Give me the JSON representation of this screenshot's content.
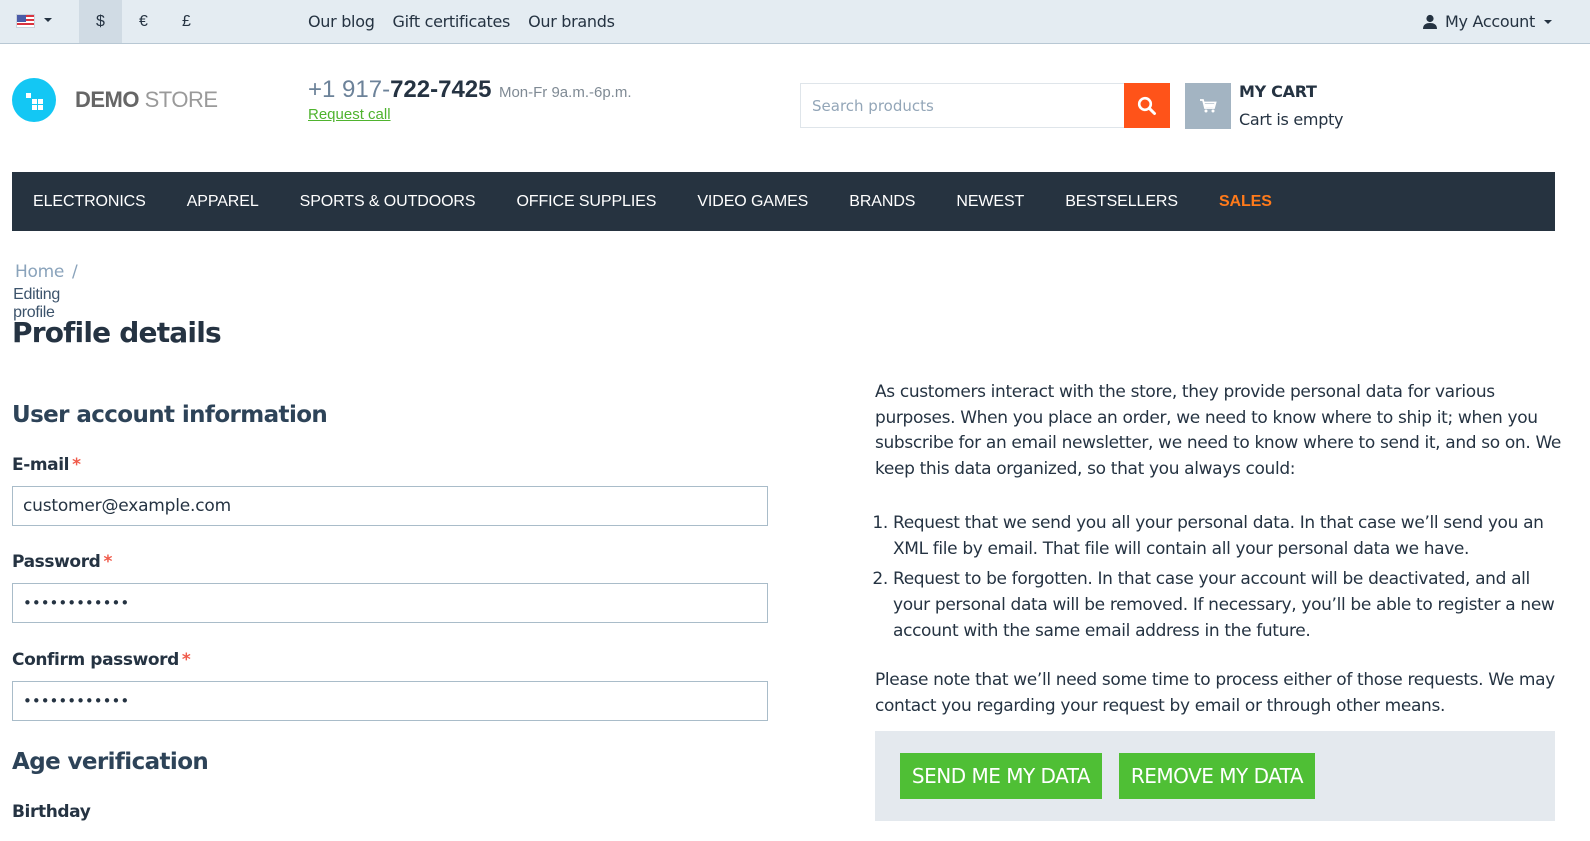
{
  "topbar": {
    "language": {
      "icon": "us-flag-icon",
      "selected": "English"
    },
    "currencies": [
      {
        "symbol": "$",
        "active": true
      },
      {
        "symbol": "€",
        "active": false
      },
      {
        "symbol": "£",
        "active": false
      }
    ],
    "links": [
      "Our blog",
      "Gift certificates",
      "Our brands"
    ],
    "account_label": "My Account"
  },
  "header": {
    "logo": {
      "bold": "DEMO",
      "light": "STORE"
    },
    "phone": {
      "prefix": "+1 917-",
      "main": "722-7425",
      "hours": "Mon-Fr 9a.m.-6p.m.",
      "request_call": "Request call"
    },
    "search": {
      "placeholder": "Search products",
      "value": ""
    },
    "cart": {
      "title": "MY CART",
      "status": "Cart is empty"
    }
  },
  "nav": {
    "items": [
      "ELECTRONICS",
      "APPAREL",
      "SPORTS & OUTDOORS",
      "OFFICE SUPPLIES",
      "VIDEO GAMES",
      "BRANDS",
      "NEWEST",
      "BESTSELLERS",
      "SALES"
    ],
    "highlight_color": "#ff7a1a"
  },
  "breadcrumb": {
    "home": "Home",
    "separator": "/",
    "current": "Editing profile"
  },
  "page_title": "Profile details",
  "form": {
    "section_account": "User account information",
    "email": {
      "label": "E-mail",
      "required": "*",
      "value": "customer@example.com"
    },
    "password": {
      "label": "Password",
      "required": "*",
      "value": "••••••••••••"
    },
    "confirm_password": {
      "label": "Confirm password",
      "required": "*",
      "value": "••••••••••••"
    },
    "section_age": "Age verification",
    "birthday": {
      "label": "Birthday"
    }
  },
  "gdpr": {
    "intro": "As customers interact with the store, they provide personal data for various purposes. When you place an order, we need to know where to ship it; when you subscribe for an email newsletter, we need to know where to send it, and so on. We keep this data organized, so that you always could:",
    "options": [
      "Request that we send you all your personal data. In that case we’ll send you an XML file by email. That file will contain all your personal data we have.",
      "Request to be forgotten. In that case your account will be deactivated, and all your personal data will be removed. If necessary, you’ll be able to register a new account with the same email address in the future."
    ],
    "note": "Please note that we’ll need some time to process either of those requests. We may contact you regarding your request by email or through other means.",
    "send_button": "SEND ME MY DATA",
    "remove_button": "REMOVE MY DATA",
    "button_color": "#4fbf35"
  }
}
